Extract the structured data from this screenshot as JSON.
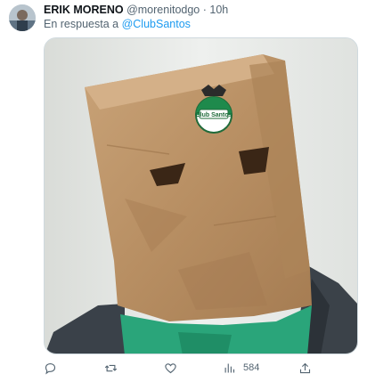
{
  "author": {
    "name": "ERIK MORENO",
    "handle": "@morenitodgo",
    "separator": "·",
    "time": "10h"
  },
  "reply": {
    "prefix": "En respuesta a",
    "mention": "@ClubSantos"
  },
  "media": {
    "logo_text": "Club Santos"
  },
  "actions": {
    "views_count": "584"
  },
  "icons": [
    "avatar",
    "reply-icon",
    "retweet-icon",
    "like-icon",
    "views-icon",
    "share-icon"
  ],
  "colors": {
    "link": "#1d9bf0",
    "muted": "#536471",
    "text": "#0f1419"
  }
}
